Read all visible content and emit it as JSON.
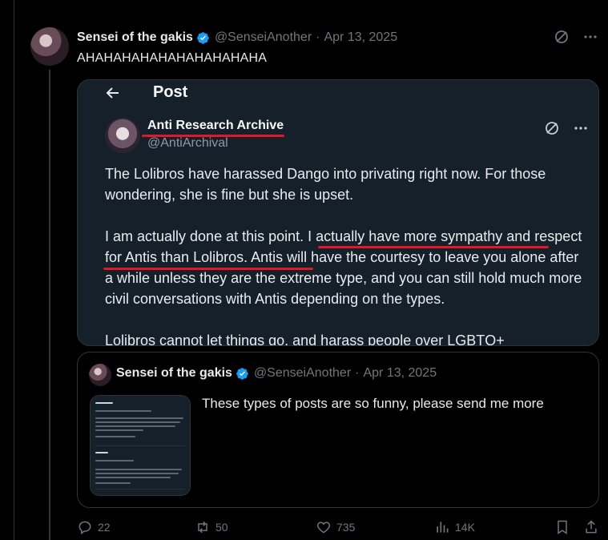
{
  "post": {
    "author_name": "Sensei of the gakis",
    "author_handle": "@SenseiAnother",
    "separator": "·",
    "date": "Apr 13, 2025",
    "text": "AHAHAHAHAHAHAHAHAHAHA"
  },
  "embedded_screenshot": {
    "header_title": "Post",
    "author_name": "Anti Research Archive",
    "author_handle": "@AntiArchival",
    "paragraph1": "The Lolibros have harassed Dango into privating right now. For those wondering, she is fine but she is upset.",
    "paragraph2_prefix": "I am actually done at this point. ",
    "paragraph2_highlight": "I actually have more sympathy and respect for Antis than Lolibros.",
    "paragraph2_suffix": " Antis will have the courtesy to leave you alone after a while unless they are the extreme type, and you can still hold much more civil conversations with Antis depending on the types.",
    "paragraph3": "Lolibros cannot let things go, and harass people over LGBTQ+"
  },
  "quoted_post": {
    "author_name": "Sensei of the gakis",
    "author_handle": "@SenseiAnother",
    "separator": "·",
    "date": "Apr 13, 2025",
    "text": "These types of posts are so funny, please send me more"
  },
  "actions": {
    "replies": "22",
    "reposts": "50",
    "likes": "735",
    "views": "14K"
  },
  "colors": {
    "verified": "#1d9bf0",
    "underline": "#e0182a",
    "secondary_text": "#71767b"
  }
}
